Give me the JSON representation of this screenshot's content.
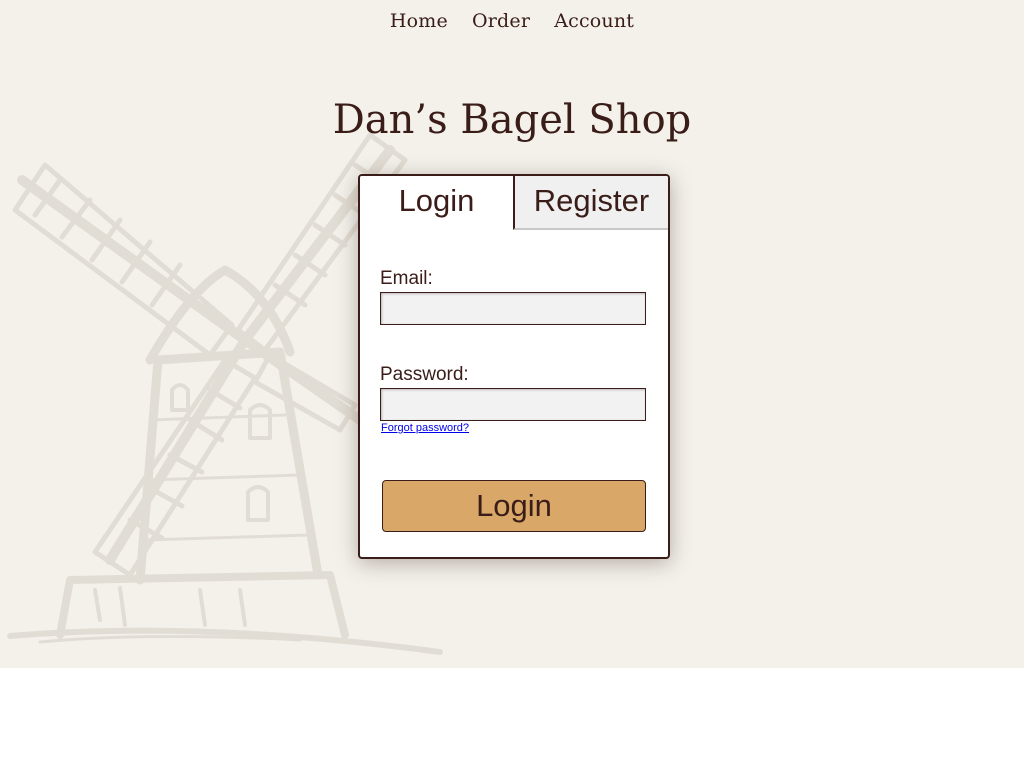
{
  "nav": {
    "items": [
      {
        "label": "Home"
      },
      {
        "label": "Order"
      },
      {
        "label": "Account"
      }
    ]
  },
  "header": {
    "title": "Dan’s Bagel Shop"
  },
  "auth": {
    "tabs": [
      {
        "label": "Login",
        "active": true
      },
      {
        "label": "Register",
        "active": false
      }
    ],
    "email_label": "Email:",
    "email_value": "",
    "password_label": "Password:",
    "password_value": "",
    "forgot_label": "Forgot password?",
    "submit_label": "Login"
  },
  "colors": {
    "background": "#f4f1eb",
    "text": "#3a1d18",
    "button": "#d9a768",
    "link": "#0000ee"
  },
  "decor": {
    "background_icon": "windmill-icon"
  }
}
